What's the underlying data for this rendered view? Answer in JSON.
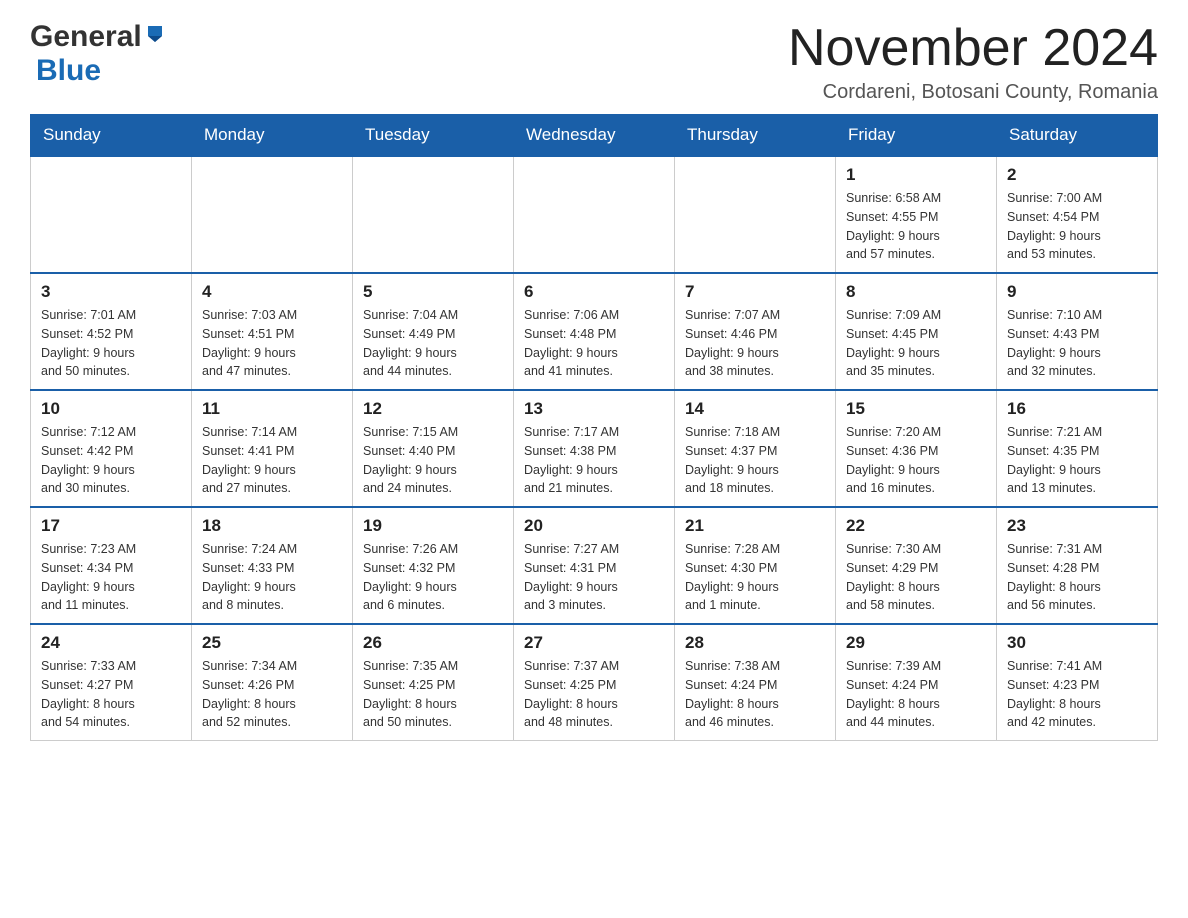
{
  "header": {
    "month_year": "November 2024",
    "location": "Cordareni, Botosani County, Romania",
    "logo_general": "General",
    "logo_blue": "Blue"
  },
  "calendar": {
    "days_of_week": [
      "Sunday",
      "Monday",
      "Tuesday",
      "Wednesday",
      "Thursday",
      "Friday",
      "Saturday"
    ],
    "weeks": [
      [
        {
          "day": "",
          "info": ""
        },
        {
          "day": "",
          "info": ""
        },
        {
          "day": "",
          "info": ""
        },
        {
          "day": "",
          "info": ""
        },
        {
          "day": "",
          "info": ""
        },
        {
          "day": "1",
          "info": "Sunrise: 6:58 AM\nSunset: 4:55 PM\nDaylight: 9 hours\nand 57 minutes."
        },
        {
          "day": "2",
          "info": "Sunrise: 7:00 AM\nSunset: 4:54 PM\nDaylight: 9 hours\nand 53 minutes."
        }
      ],
      [
        {
          "day": "3",
          "info": "Sunrise: 7:01 AM\nSunset: 4:52 PM\nDaylight: 9 hours\nand 50 minutes."
        },
        {
          "day": "4",
          "info": "Sunrise: 7:03 AM\nSunset: 4:51 PM\nDaylight: 9 hours\nand 47 minutes."
        },
        {
          "day": "5",
          "info": "Sunrise: 7:04 AM\nSunset: 4:49 PM\nDaylight: 9 hours\nand 44 minutes."
        },
        {
          "day": "6",
          "info": "Sunrise: 7:06 AM\nSunset: 4:48 PM\nDaylight: 9 hours\nand 41 minutes."
        },
        {
          "day": "7",
          "info": "Sunrise: 7:07 AM\nSunset: 4:46 PM\nDaylight: 9 hours\nand 38 minutes."
        },
        {
          "day": "8",
          "info": "Sunrise: 7:09 AM\nSunset: 4:45 PM\nDaylight: 9 hours\nand 35 minutes."
        },
        {
          "day": "9",
          "info": "Sunrise: 7:10 AM\nSunset: 4:43 PM\nDaylight: 9 hours\nand 32 minutes."
        }
      ],
      [
        {
          "day": "10",
          "info": "Sunrise: 7:12 AM\nSunset: 4:42 PM\nDaylight: 9 hours\nand 30 minutes."
        },
        {
          "day": "11",
          "info": "Sunrise: 7:14 AM\nSunset: 4:41 PM\nDaylight: 9 hours\nand 27 minutes."
        },
        {
          "day": "12",
          "info": "Sunrise: 7:15 AM\nSunset: 4:40 PM\nDaylight: 9 hours\nand 24 minutes."
        },
        {
          "day": "13",
          "info": "Sunrise: 7:17 AM\nSunset: 4:38 PM\nDaylight: 9 hours\nand 21 minutes."
        },
        {
          "day": "14",
          "info": "Sunrise: 7:18 AM\nSunset: 4:37 PM\nDaylight: 9 hours\nand 18 minutes."
        },
        {
          "day": "15",
          "info": "Sunrise: 7:20 AM\nSunset: 4:36 PM\nDaylight: 9 hours\nand 16 minutes."
        },
        {
          "day": "16",
          "info": "Sunrise: 7:21 AM\nSunset: 4:35 PM\nDaylight: 9 hours\nand 13 minutes."
        }
      ],
      [
        {
          "day": "17",
          "info": "Sunrise: 7:23 AM\nSunset: 4:34 PM\nDaylight: 9 hours\nand 11 minutes."
        },
        {
          "day": "18",
          "info": "Sunrise: 7:24 AM\nSunset: 4:33 PM\nDaylight: 9 hours\nand 8 minutes."
        },
        {
          "day": "19",
          "info": "Sunrise: 7:26 AM\nSunset: 4:32 PM\nDaylight: 9 hours\nand 6 minutes."
        },
        {
          "day": "20",
          "info": "Sunrise: 7:27 AM\nSunset: 4:31 PM\nDaylight: 9 hours\nand 3 minutes."
        },
        {
          "day": "21",
          "info": "Sunrise: 7:28 AM\nSunset: 4:30 PM\nDaylight: 9 hours\nand 1 minute."
        },
        {
          "day": "22",
          "info": "Sunrise: 7:30 AM\nSunset: 4:29 PM\nDaylight: 8 hours\nand 58 minutes."
        },
        {
          "day": "23",
          "info": "Sunrise: 7:31 AM\nSunset: 4:28 PM\nDaylight: 8 hours\nand 56 minutes."
        }
      ],
      [
        {
          "day": "24",
          "info": "Sunrise: 7:33 AM\nSunset: 4:27 PM\nDaylight: 8 hours\nand 54 minutes."
        },
        {
          "day": "25",
          "info": "Sunrise: 7:34 AM\nSunset: 4:26 PM\nDaylight: 8 hours\nand 52 minutes."
        },
        {
          "day": "26",
          "info": "Sunrise: 7:35 AM\nSunset: 4:25 PM\nDaylight: 8 hours\nand 50 minutes."
        },
        {
          "day": "27",
          "info": "Sunrise: 7:37 AM\nSunset: 4:25 PM\nDaylight: 8 hours\nand 48 minutes."
        },
        {
          "day": "28",
          "info": "Sunrise: 7:38 AM\nSunset: 4:24 PM\nDaylight: 8 hours\nand 46 minutes."
        },
        {
          "day": "29",
          "info": "Sunrise: 7:39 AM\nSunset: 4:24 PM\nDaylight: 8 hours\nand 44 minutes."
        },
        {
          "day": "30",
          "info": "Sunrise: 7:41 AM\nSunset: 4:23 PM\nDaylight: 8 hours\nand 42 minutes."
        }
      ]
    ]
  }
}
